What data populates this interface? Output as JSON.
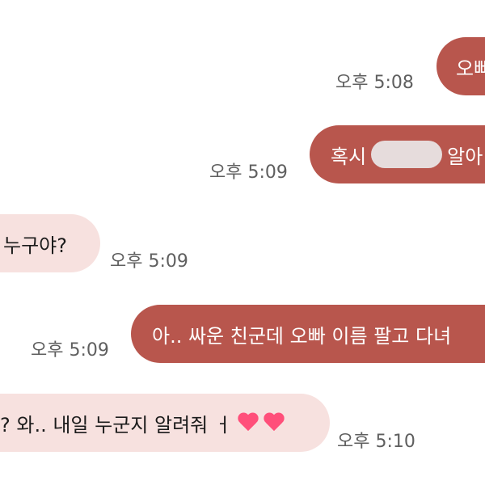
{
  "messages": [
    {
      "direction": "sent",
      "text": "오빠",
      "time": "오후 5:08"
    },
    {
      "direction": "sent",
      "text_before": "혹시",
      "text_after": "알아",
      "time": "오후 5:09"
    },
    {
      "direction": "received",
      "text": "누구야?",
      "time": "오후 5:09"
    },
    {
      "direction": "sent",
      "text": "아.. 싸운 친군데 오빠 이름 팔고 다녀",
      "time": "오후 5:09"
    },
    {
      "direction": "received",
      "text": "? 와.. 내일 누군지 알려줘 ㅓ",
      "time": "오후 5:10"
    }
  ],
  "colors": {
    "sent_bubble": "#b8564d",
    "received_bubble": "#f7e1df",
    "time_text": "#5f5f5f"
  },
  "icons": [
    "heart-icon",
    "heart-icon"
  ]
}
